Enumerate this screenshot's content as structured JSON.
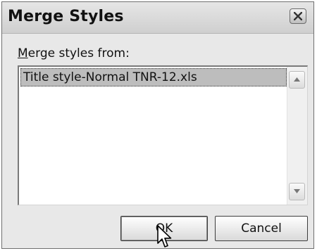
{
  "dialog": {
    "title": "Merge Styles",
    "close_icon": "close-icon",
    "merge_label_accel": "M",
    "merge_label_rest": "erge styles from:",
    "list_items": [
      "Title style-Normal TNR-12.xls"
    ],
    "ok_label": "OK",
    "cancel_label": "Cancel"
  },
  "icons": {
    "scroll_up": "chevron-up-icon",
    "scroll_down": "chevron-down-icon",
    "cursor": "mouse-pointer-icon"
  },
  "colors": {
    "dialog_bg": "#e8e8e8",
    "selection_bg": "#bdbdbd"
  }
}
